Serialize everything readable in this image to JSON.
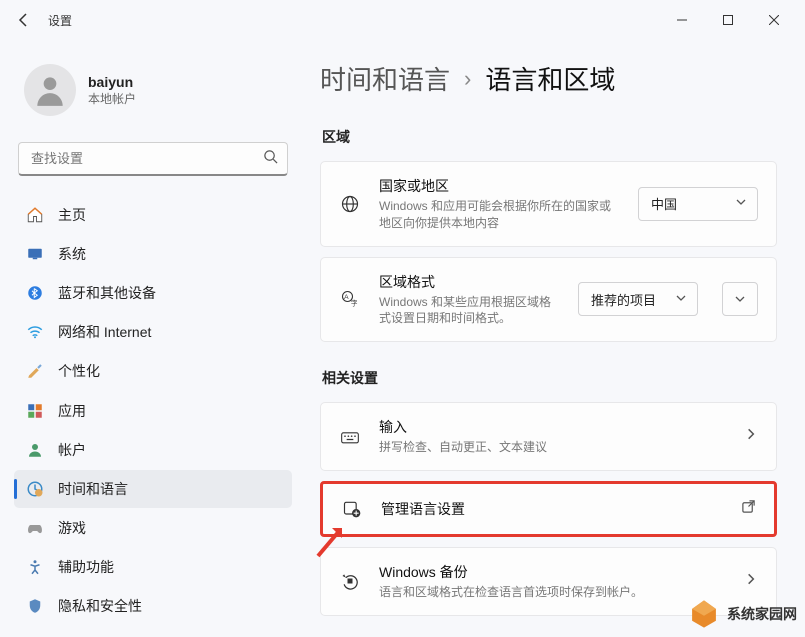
{
  "app_title": "设置",
  "profile": {
    "name": "baiyun",
    "sub": "本地帐户"
  },
  "search": {
    "placeholder": "查找设置"
  },
  "nav": {
    "home": "主页",
    "system": "系统",
    "bluetooth": "蓝牙和其他设备",
    "network": "网络和 Internet",
    "personalization": "个性化",
    "apps": "应用",
    "accounts": "帐户",
    "time_language": "时间和语言",
    "gaming": "游戏",
    "accessibility": "辅助功能",
    "privacy": "隐私和安全性"
  },
  "breadcrumb": {
    "parent": "时间和语言",
    "sep": "›",
    "current": "语言和区域"
  },
  "sections": {
    "region": "区域",
    "related": "相关设置"
  },
  "region_card": {
    "title": "国家或地区",
    "sub": "Windows 和应用可能会根据你所在的国家或地区向你提供本地内容",
    "value": "中国"
  },
  "format_card": {
    "title": "区域格式",
    "sub": "Windows 和某些应用根据区域格式设置日期和时间格式。",
    "value": "推荐的项目"
  },
  "input_card": {
    "title": "输入",
    "sub": "拼写检查、自动更正、文本建议"
  },
  "manage_card": {
    "title": "管理语言设置"
  },
  "backup_card": {
    "title": "Windows 备份",
    "sub": "语言和区域格式在检查语言首选项时保存到帐户。"
  },
  "watermark": "系统家园网"
}
